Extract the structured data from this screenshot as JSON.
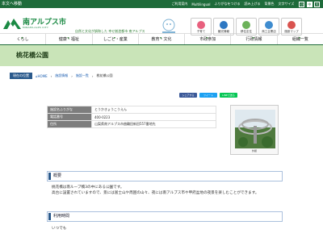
{
  "topbar": {
    "skip": "本文へ移動",
    "links": [
      "ご利用案内",
      "Multilingual",
      "ふりがなをつける",
      "読み上げる"
    ],
    "bg_label": "背景色",
    "size_label": "文字サイズ",
    "sizes": [
      "小",
      "中",
      "大"
    ],
    "active_size": "中"
  },
  "header": {
    "logo_text": "南アルプス市",
    "logo_sub": "MINAMI-ALPS CITY",
    "tagline": "自然と文化が調和した 幸せ創造都市 南アルプス",
    "quick": [
      {
        "label": "子育て",
        "color": "#e8607e"
      },
      {
        "label": "観光情報",
        "color": "#2d77c2"
      },
      {
        "label": "移住定住",
        "color": "#6cb25a"
      },
      {
        "label": "商工企業店",
        "color": "#3f8ccf"
      },
      {
        "label": "施設マップ",
        "color": "#d9534f"
      }
    ]
  },
  "gnav": [
    "くらし",
    "健康・福祉",
    "しごと・産業",
    "教育・文化",
    "市政参加",
    "行政情報",
    "組織一覧"
  ],
  "page": {
    "title": "桃花橋公園"
  },
  "breadcrumb": {
    "label": "現在の位置",
    "items": [
      "HOME",
      "施設情報",
      "施設一覧",
      "桃花橋公園"
    ]
  },
  "share": [
    {
      "label": "シェアする",
      "color": "#3b5998"
    },
    {
      "label": "ツイート",
      "color": "#1da1f2"
    },
    {
      "label": "LINEで送る",
      "color": "#06c755"
    }
  ],
  "info": {
    "rows": [
      {
        "key": "施設名ふりがな",
        "value": "とうかきょうこうえん"
      },
      {
        "key": "電話番号",
        "value": "400-0223"
      },
      {
        "key": "住所",
        "value": "山梨県南アルプス市曲輪田新田557番地先"
      }
    ]
  },
  "photo": {
    "caption": "外観"
  },
  "overview": {
    "heading": "概要",
    "lines": [
      "桃花橋は南ループ橋3の中にある公園です。",
      "高台に設置されていますので、景には富士山や周囲の山々、夜には南アルプス市や甲府盆地の夜景を楽しむことができます。"
    ]
  },
  "hours": {
    "heading": "利用時間",
    "text": "いつでも"
  }
}
